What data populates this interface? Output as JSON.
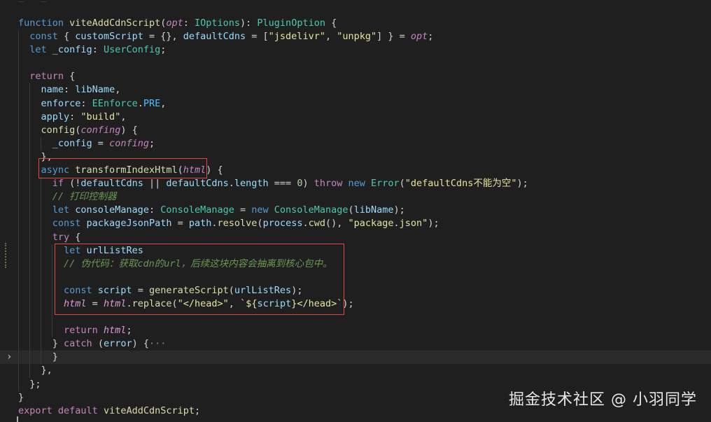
{
  "editor": {
    "colors": {
      "background": "#1f1f1f",
      "annotation_box": "#e04a3d",
      "keyword": "#c586c0",
      "function": "#dcdcaa",
      "type": "#4ec9b0",
      "string": "#ce9178",
      "comment": "#6a9955"
    },
    "fold_indicator_line": 25,
    "highlighted_line": 25,
    "lines": [
      {
        "guides": [],
        "tokens": [
          {
            "t": "function ",
            "c": "kb"
          },
          {
            "t": "viteAddCdnScript",
            "c": "fn"
          },
          {
            "t": "(",
            "c": "pu"
          },
          {
            "t": "opt",
            "c": "pm"
          },
          {
            "t": ": ",
            "c": "op"
          },
          {
            "t": "IOptions",
            "c": "ty"
          },
          {
            "t": "): ",
            "c": "op"
          },
          {
            "t": "PluginOption",
            "c": "ty"
          },
          {
            "t": " {",
            "c": "pu"
          }
        ]
      },
      {
        "guides": [
          1
        ],
        "tokens": [
          {
            "t": "  const ",
            "c": "kb"
          },
          {
            "t": "{ ",
            "c": "pu"
          },
          {
            "t": "customScript",
            "c": "vr"
          },
          {
            "t": " = {}, ",
            "c": "op"
          },
          {
            "t": "defaultCdns",
            "c": "vr"
          },
          {
            "t": " = [",
            "c": "op"
          },
          {
            "t": "\"jsdelivr\"",
            "c": "stg"
          },
          {
            "t": ", ",
            "c": "op"
          },
          {
            "t": "\"unpkg\"",
            "c": "stg"
          },
          {
            "t": "] } = ",
            "c": "op"
          },
          {
            "t": "opt",
            "c": "pm"
          },
          {
            "t": ";",
            "c": "pu"
          }
        ]
      },
      {
        "guides": [
          1
        ],
        "tokens": [
          {
            "t": "  let ",
            "c": "kb"
          },
          {
            "t": "_config",
            "c": "vr"
          },
          {
            "t": ": ",
            "c": "op"
          },
          {
            "t": "UserConfig",
            "c": "ty"
          },
          {
            "t": ";",
            "c": "pu"
          }
        ]
      },
      {
        "guides": [
          1
        ],
        "tokens": []
      },
      {
        "guides": [
          1
        ],
        "tokens": [
          {
            "t": "  return ",
            "c": "kw"
          },
          {
            "t": "{",
            "c": "pu"
          }
        ]
      },
      {
        "guides": [
          1,
          2
        ],
        "tokens": [
          {
            "t": "    name",
            "c": "pr"
          },
          {
            "t": ": ",
            "c": "op"
          },
          {
            "t": "libName",
            "c": "vr"
          },
          {
            "t": ",",
            "c": "pu"
          }
        ]
      },
      {
        "guides": [
          1,
          2
        ],
        "tokens": [
          {
            "t": "    enforce",
            "c": "pr"
          },
          {
            "t": ": ",
            "c": "op"
          },
          {
            "t": "EEnforce",
            "c": "ty"
          },
          {
            "t": ".",
            "c": "op"
          },
          {
            "t": "PRE",
            "c": "cn"
          },
          {
            "t": ",",
            "c": "pu"
          }
        ]
      },
      {
        "guides": [
          1,
          2
        ],
        "tokens": [
          {
            "t": "    apply",
            "c": "pr"
          },
          {
            "t": ": ",
            "c": "op"
          },
          {
            "t": "\"build\"",
            "c": "stg"
          },
          {
            "t": ",",
            "c": "pu"
          }
        ]
      },
      {
        "guides": [
          1,
          2
        ],
        "tokens": [
          {
            "t": "    config",
            "c": "fn"
          },
          {
            "t": "(",
            "c": "pu"
          },
          {
            "t": "confing",
            "c": "pm"
          },
          {
            "t": ") {",
            "c": "pu"
          }
        ]
      },
      {
        "guides": [
          1,
          2,
          3
        ],
        "tokens": [
          {
            "t": "      _config",
            "c": "vr"
          },
          {
            "t": " = ",
            "c": "op"
          },
          {
            "t": "confing",
            "c": "pm"
          },
          {
            "t": ";",
            "c": "pu"
          }
        ]
      },
      {
        "guides": [
          1,
          2
        ],
        "tokens": [
          {
            "t": "    },",
            "c": "pu"
          }
        ]
      },
      {
        "guides": [
          1,
          2
        ],
        "tokens": [
          {
            "t": "    async ",
            "c": "kb"
          },
          {
            "t": "transformIndexHtml",
            "c": "fn"
          },
          {
            "t": "(",
            "c": "pu"
          },
          {
            "t": "html",
            "c": "pm"
          },
          {
            "t": ") {",
            "c": "pu"
          }
        ]
      },
      {
        "guides": [
          1,
          2,
          3
        ],
        "tokens": [
          {
            "t": "      if ",
            "c": "kw"
          },
          {
            "t": "(!",
            "c": "op"
          },
          {
            "t": "defaultCdns",
            "c": "vr"
          },
          {
            "t": " || ",
            "c": "op"
          },
          {
            "t": "defaultCdns",
            "c": "vr"
          },
          {
            "t": ".",
            "c": "op"
          },
          {
            "t": "length",
            "c": "pr"
          },
          {
            "t": " === ",
            "c": "op"
          },
          {
            "t": "0",
            "c": "nm"
          },
          {
            "t": ") ",
            "c": "op"
          },
          {
            "t": "throw ",
            "c": "kw"
          },
          {
            "t": "new ",
            "c": "kb"
          },
          {
            "t": "Error",
            "c": "ty"
          },
          {
            "t": "(",
            "c": "pu"
          },
          {
            "t": "\"defaultCdns不能为空\"",
            "c": "stg"
          },
          {
            "t": ");",
            "c": "pu"
          }
        ]
      },
      {
        "guides": [
          1,
          2,
          3
        ],
        "tokens": [
          {
            "t": "      // 打印控制器",
            "c": "cm"
          }
        ]
      },
      {
        "guides": [
          1,
          2,
          3
        ],
        "tokens": [
          {
            "t": "      let ",
            "c": "kb"
          },
          {
            "t": "consoleManage",
            "c": "vr"
          },
          {
            "t": ": ",
            "c": "op"
          },
          {
            "t": "ConsoleManage",
            "c": "ty"
          },
          {
            "t": " = ",
            "c": "op"
          },
          {
            "t": "new ",
            "c": "kb"
          },
          {
            "t": "ConsoleManage",
            "c": "ty"
          },
          {
            "t": "(",
            "c": "pu"
          },
          {
            "t": "libName",
            "c": "vr"
          },
          {
            "t": ");",
            "c": "pu"
          }
        ]
      },
      {
        "guides": [
          1,
          2,
          3
        ],
        "tokens": [
          {
            "t": "      const ",
            "c": "kb"
          },
          {
            "t": "packageJsonPath",
            "c": "vr"
          },
          {
            "t": " = ",
            "c": "op"
          },
          {
            "t": "path",
            "c": "vr"
          },
          {
            "t": ".",
            "c": "op"
          },
          {
            "t": "resolve",
            "c": "fn"
          },
          {
            "t": "(",
            "c": "pu"
          },
          {
            "t": "process",
            "c": "vr"
          },
          {
            "t": ".",
            "c": "op"
          },
          {
            "t": "cwd",
            "c": "fn"
          },
          {
            "t": "(), ",
            "c": "pu"
          },
          {
            "t": "\"package.json\"",
            "c": "stg"
          },
          {
            "t": ");",
            "c": "pu"
          }
        ]
      },
      {
        "guides": [
          1,
          2,
          3
        ],
        "tokens": [
          {
            "t": "      try ",
            "c": "kw"
          },
          {
            "t": "{",
            "c": "pu"
          }
        ]
      },
      {
        "guides": [
          1,
          2,
          3,
          4
        ],
        "tokens": [
          {
            "t": "        let ",
            "c": "kb"
          },
          {
            "t": "urlListRes",
            "c": "vr"
          }
        ]
      },
      {
        "guides": [
          1,
          2,
          3,
          4
        ],
        "tokens": [
          {
            "t": "        // 伪代码：获取cdn的url，后续这块内容会抽离到核心包中。",
            "c": "cm"
          }
        ]
      },
      {
        "guides": [
          1,
          2,
          3,
          4
        ],
        "tokens": []
      },
      {
        "guides": [
          1,
          2,
          3,
          4
        ],
        "tokens": [
          {
            "t": "        const ",
            "c": "kb"
          },
          {
            "t": "script",
            "c": "vr"
          },
          {
            "t": " = ",
            "c": "op"
          },
          {
            "t": "generateScript",
            "c": "fn"
          },
          {
            "t": "(",
            "c": "pu"
          },
          {
            "t": "urlListRes",
            "c": "vr"
          },
          {
            "t": ");",
            "c": "pu"
          }
        ]
      },
      {
        "guides": [
          1,
          2,
          3,
          4
        ],
        "tokens": [
          {
            "t": "        html",
            "c": "pv"
          },
          {
            "t": " = ",
            "c": "op"
          },
          {
            "t": "html",
            "c": "pv"
          },
          {
            "t": ".",
            "c": "op"
          },
          {
            "t": "replace",
            "c": "fn"
          },
          {
            "t": "(",
            "c": "pu"
          },
          {
            "t": "\"</head>\"",
            "c": "stg"
          },
          {
            "t": ", ",
            "c": "op"
          },
          {
            "t": "`${",
            "c": "stg"
          },
          {
            "t": "script",
            "c": "vr"
          },
          {
            "t": "}</head>`",
            "c": "stg"
          },
          {
            "t": ");",
            "c": "pu"
          }
        ]
      },
      {
        "guides": [
          1,
          2,
          3,
          4
        ],
        "tokens": []
      },
      {
        "guides": [
          1,
          2,
          3,
          4
        ],
        "tokens": [
          {
            "t": "        return ",
            "c": "kw"
          },
          {
            "t": "html",
            "c": "pv"
          },
          {
            "t": ";",
            "c": "pu"
          }
        ]
      },
      {
        "guides": [
          1,
          2,
          3
        ],
        "tokens": [
          {
            "t": "      } ",
            "c": "pu"
          },
          {
            "t": "catch ",
            "c": "kw"
          },
          {
            "t": "(",
            "c": "pu"
          },
          {
            "t": "error",
            "c": "vr"
          },
          {
            "t": ") {",
            "c": "pu"
          },
          {
            "t": "···",
            "c": "dim"
          }
        ]
      },
      {
        "guides": [
          1,
          2,
          3
        ],
        "tokens": [
          {
            "t": "      }",
            "c": "pu"
          }
        ]
      },
      {
        "guides": [
          1,
          2
        ],
        "tokens": [
          {
            "t": "    },",
            "c": "pu"
          }
        ]
      },
      {
        "guides": [
          1
        ],
        "tokens": [
          {
            "t": "  };",
            "c": "pu"
          }
        ]
      },
      {
        "guides": [],
        "tokens": [
          {
            "t": "}",
            "c": "pu"
          }
        ]
      },
      {
        "guides": [],
        "tokens": [
          {
            "t": "export ",
            "c": "kw"
          },
          {
            "t": "default ",
            "c": "kw"
          },
          {
            "t": "viteAddCdnScript",
            "c": "fn"
          },
          {
            "t": ";",
            "c": "pu"
          }
        ]
      }
    ]
  },
  "watermark": {
    "text": "掘金技术社区 @ 小羽同学"
  }
}
